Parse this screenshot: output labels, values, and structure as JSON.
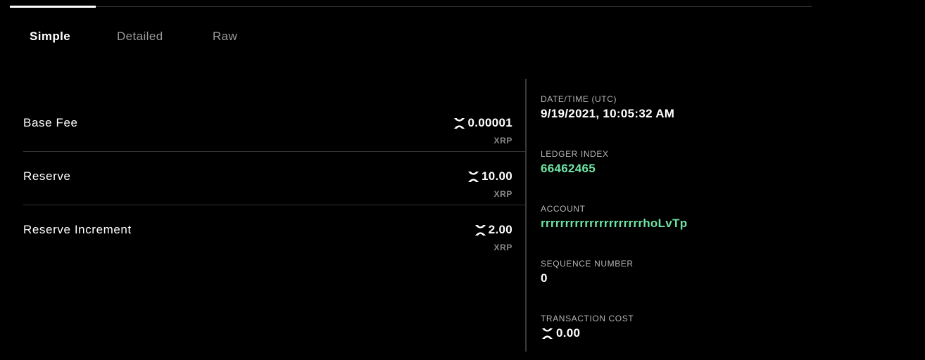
{
  "tabs": [
    {
      "label": "Simple",
      "active": true
    },
    {
      "label": "Detailed",
      "active": false
    },
    {
      "label": "Raw",
      "active": false
    }
  ],
  "fees": [
    {
      "label": "Base Fee",
      "amount": "0.00001",
      "currency": "XRP"
    },
    {
      "label": "Reserve",
      "amount": "10.00",
      "currency": "XRP"
    },
    {
      "label": "Reserve Increment",
      "amount": "2.00",
      "currency": "XRP"
    }
  ],
  "details": {
    "datetime_label": "DATE/TIME (UTC)",
    "datetime_value": "9/19/2021, 10:05:32 AM",
    "ledger_label": "LEDGER INDEX",
    "ledger_value": "66462465",
    "account_label": "ACCOUNT",
    "account_value": "rrrrrrrrrrrrrrrrrrrrrhoLvTp",
    "sequence_label": "SEQUENCE NUMBER",
    "sequence_value": "0",
    "cost_label": "TRANSACTION COST",
    "cost_value": "0.00"
  },
  "colors": {
    "background": "#000000",
    "link": "#6fe3a3",
    "muted": "#8a8a8a"
  },
  "icons": {
    "currency": "xrp-icon"
  }
}
